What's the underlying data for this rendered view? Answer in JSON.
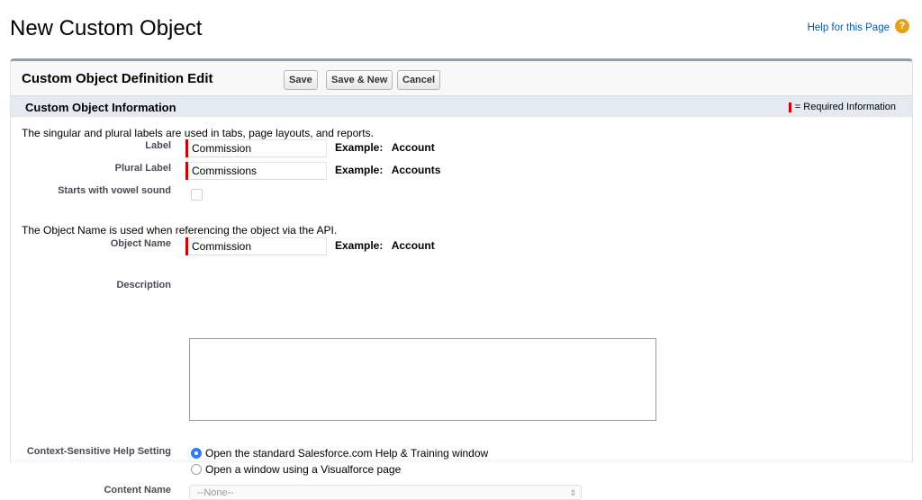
{
  "page": {
    "title": "New Custom Object",
    "help_link": "Help for this Page",
    "help_icon_glyph": "?"
  },
  "panel": {
    "title": "Custom Object Definition Edit",
    "buttons": {
      "save": "Save",
      "save_new": "Save & New",
      "cancel": "Cancel"
    }
  },
  "section": {
    "title": "Custom Object Information",
    "required_info": "= Required Information"
  },
  "form": {
    "labels_intro": "The singular and plural labels are used in tabs, page layouts, and reports.",
    "label": {
      "label": "Label",
      "value": "Commission",
      "example_prefix": "Example:",
      "example_value": "Account"
    },
    "plural_label": {
      "label": "Plural Label",
      "value": "Commissions",
      "example_prefix": "Example:",
      "example_value": "Accounts"
    },
    "vowel": {
      "label": "Starts with vowel sound",
      "checked": false
    },
    "object_intro": "The Object Name is used when referencing the object via the API.",
    "object_name": {
      "label": "Object Name",
      "value": "Commission",
      "example_prefix": "Example:",
      "example_value": "Account"
    },
    "description": {
      "label": "Description",
      "value": ""
    },
    "help_setting": {
      "label": "Context-Sensitive Help Setting",
      "option_standard": "Open the standard Salesforce.com Help & Training window",
      "option_visualforce": "Open a window using a Visualforce page",
      "selected": "standard"
    },
    "content_name": {
      "label": "Content Name",
      "value": "--None--"
    }
  },
  "colors": {
    "required": "#cc0000",
    "panel_border": "#8a9ebe",
    "section_bg": "#e5eaf2",
    "link": "#015ba7",
    "radio_selected": "#2f7df6"
  }
}
